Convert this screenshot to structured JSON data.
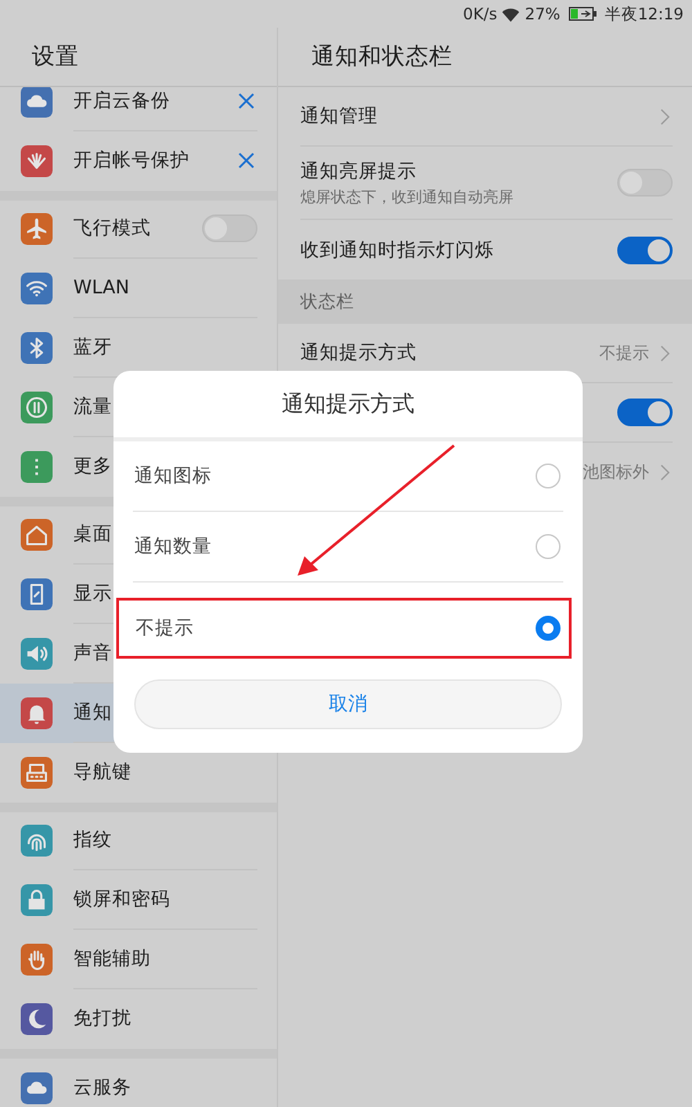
{
  "status_bar": {
    "speed": "0K/s",
    "battery": "27%",
    "time": "半夜12:19"
  },
  "sidebar": {
    "title": "设置",
    "groups": [
      {
        "items": [
          {
            "label": "开启云备份",
            "kind": "prompt",
            "selected": false
          },
          {
            "label": "开启帐号保护",
            "kind": "prompt",
            "selected": false
          }
        ]
      },
      {
        "items": [
          {
            "label": "飞行模式",
            "kind": "toggle",
            "on": false,
            "selected": false
          },
          {
            "label": "WLAN",
            "kind": "link",
            "selected": false
          },
          {
            "label": "蓝牙",
            "kind": "link",
            "selected": false
          },
          {
            "label": "流量",
            "kind": "link",
            "selected": false
          },
          {
            "label": "更多",
            "kind": "link",
            "selected": false
          }
        ]
      },
      {
        "items": [
          {
            "label": "桌面",
            "kind": "link",
            "selected": false
          },
          {
            "label": "显示",
            "kind": "link",
            "selected": false
          },
          {
            "label": "声音",
            "kind": "link",
            "selected": false
          },
          {
            "label": "通知",
            "kind": "link",
            "selected": true
          },
          {
            "label": "导航键",
            "kind": "link",
            "selected": false
          }
        ]
      },
      {
        "items": [
          {
            "label": "指纹",
            "kind": "link",
            "selected": false
          },
          {
            "label": "锁屏和密码",
            "kind": "link",
            "selected": false
          },
          {
            "label": "智能辅助",
            "kind": "link",
            "selected": false
          },
          {
            "label": "免打扰",
            "kind": "link",
            "selected": false
          }
        ]
      },
      {
        "items": [
          {
            "label": "云服务",
            "kind": "link",
            "selected": false
          }
        ]
      }
    ]
  },
  "panel": {
    "title": "通知和状态栏",
    "rows": [
      {
        "kind": "link",
        "label": "通知管理"
      },
      {
        "kind": "toggle",
        "label": "通知亮屏提示",
        "subtitle": "熄屏状态下，收到通知自动亮屏",
        "on": false
      },
      {
        "kind": "toggle",
        "label": "收到通知时指示灯闪烁",
        "on": true
      },
      {
        "kind": "section",
        "label": "状态栏"
      },
      {
        "kind": "link",
        "label": "通知提示方式",
        "value": "不提示"
      },
      {
        "kind": "toggle",
        "on": true
      },
      {
        "kind": "link",
        "value": "池图标外"
      }
    ]
  },
  "dialog": {
    "title": "通知提示方式",
    "options": [
      {
        "label": "通知图标",
        "selected": false,
        "marked": false
      },
      {
        "label": "通知数量",
        "selected": false,
        "marked": false
      },
      {
        "label": "不提示",
        "selected": true,
        "marked": true
      }
    ],
    "arrow": true,
    "cancel": "取消"
  }
}
